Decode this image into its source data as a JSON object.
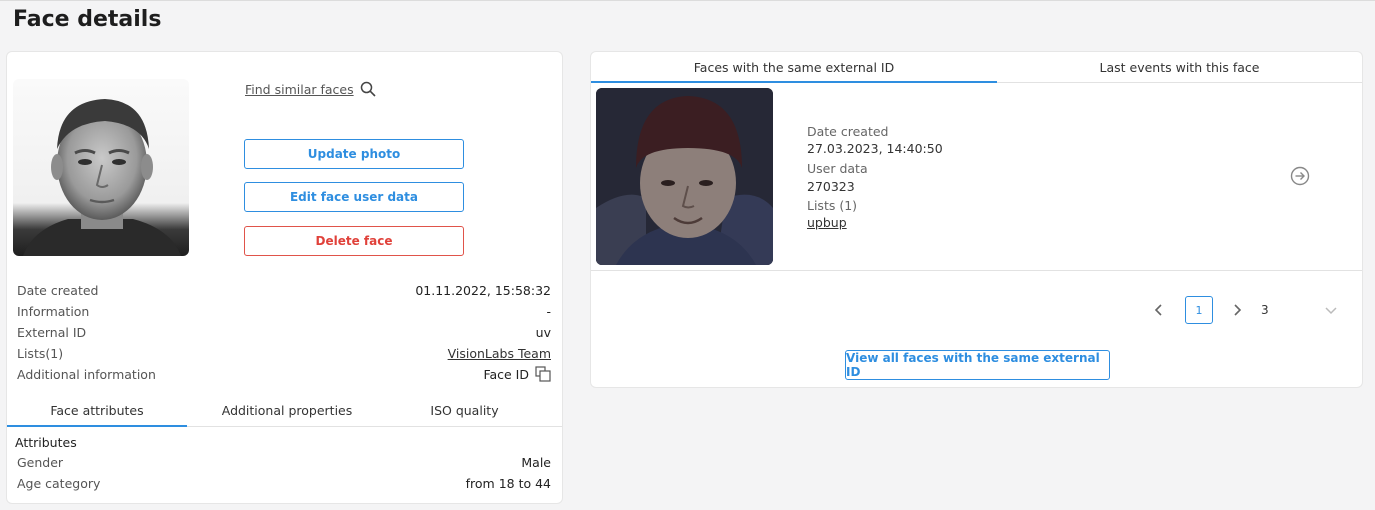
{
  "page": {
    "title": "Face details"
  },
  "left": {
    "find_similar": "Find similar faces",
    "buttons": {
      "update": "Update photo",
      "edit": "Edit face user data",
      "delete": "Delete face"
    },
    "info": [
      {
        "label": "Date created",
        "value": "01.11.2022, 15:58:32"
      },
      {
        "label": "Information",
        "value": "-"
      },
      {
        "label": "External ID",
        "value": "uv"
      },
      {
        "label": "Lists(1)",
        "value": "VisionLabs Team"
      },
      {
        "label": "Additional information",
        "value": "Face ID"
      }
    ],
    "tabs": [
      "Face attributes",
      "Additional properties",
      "ISO quality"
    ],
    "attributes_title": "Attributes",
    "attributes": [
      {
        "label": "Gender",
        "value": "Male"
      },
      {
        "label": "Age category",
        "value": "from 18 to 44"
      }
    ]
  },
  "right": {
    "tabs": [
      "Faces with the same external ID",
      "Last events with this face"
    ],
    "face": {
      "date_label": "Date created",
      "date_value": "27.03.2023, 14:40:50",
      "user_data_label": "User data",
      "user_data_value": "270323",
      "lists_label": "Lists (1)",
      "lists_value": "upbup"
    },
    "pagination": {
      "current": "1",
      "last": "3"
    },
    "view_all": "View all faces with the same external ID"
  },
  "colors": {
    "accent": "#2e8ee0",
    "danger": "#e0413a"
  }
}
